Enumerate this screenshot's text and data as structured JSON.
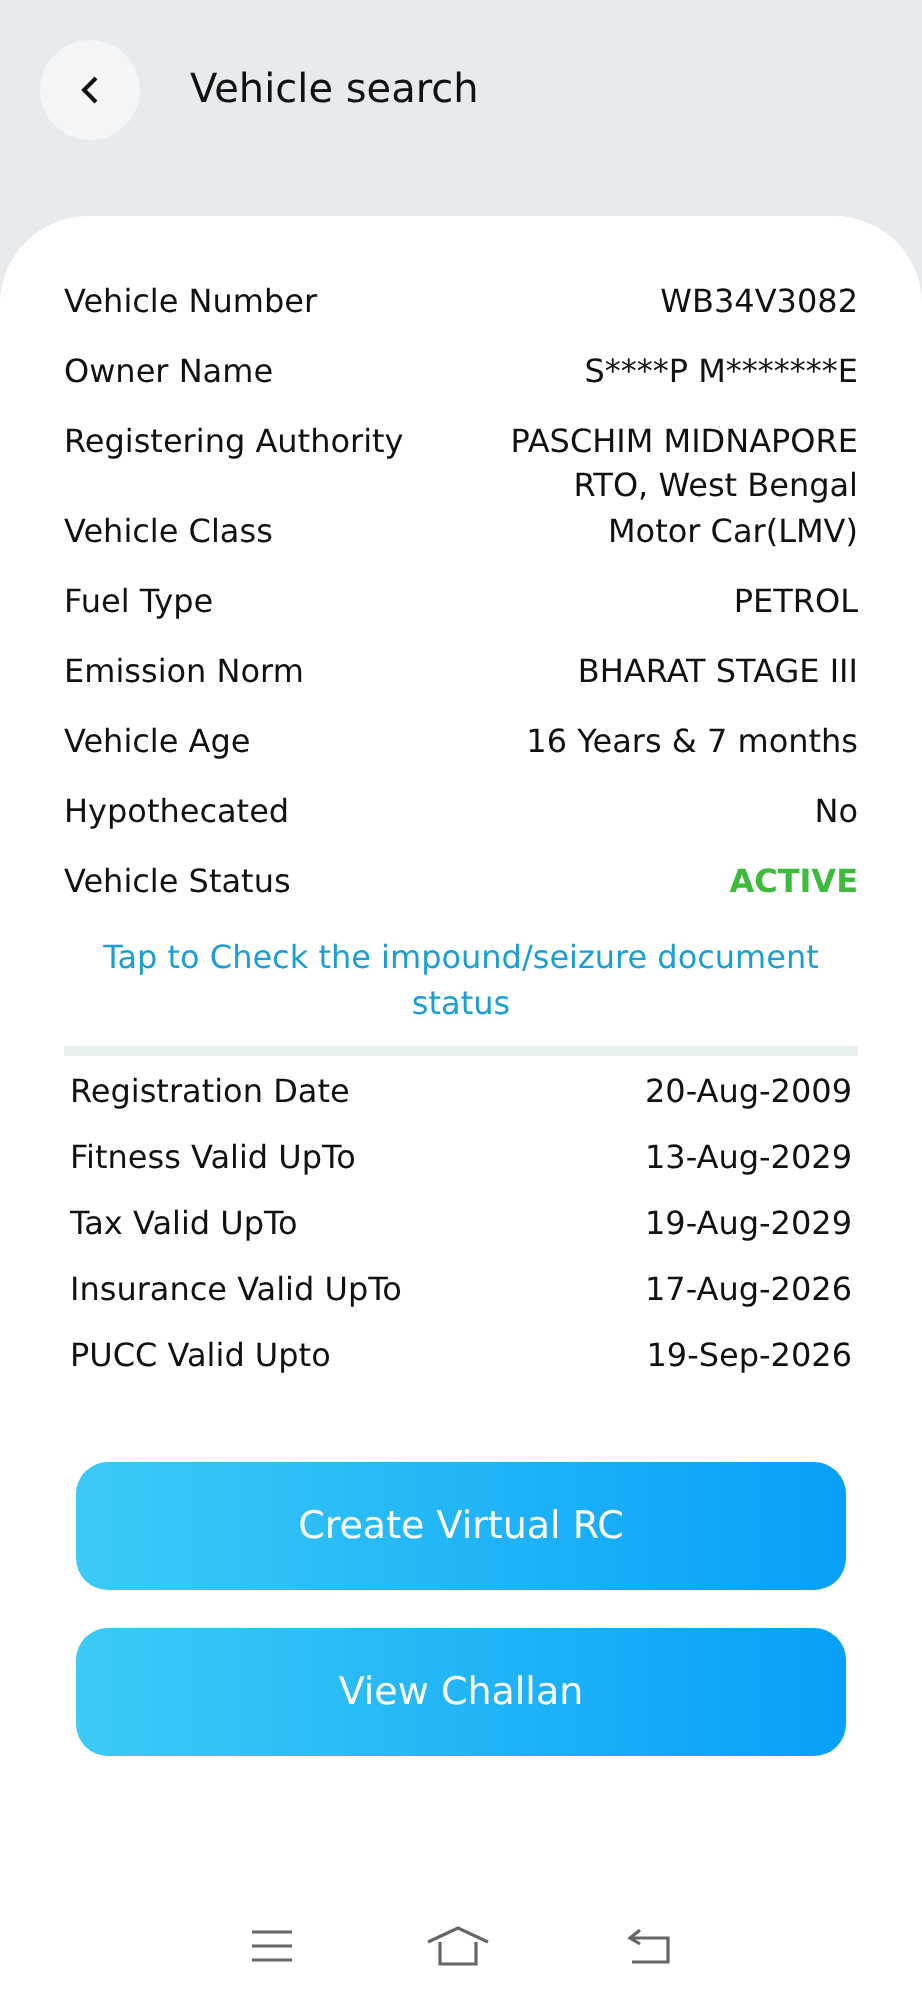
{
  "header": {
    "title": "Vehicle search"
  },
  "details": [
    {
      "label": "Vehicle Number",
      "value": "WB34V3082",
      "kind": "text"
    },
    {
      "label": "Owner Name",
      "value": "S****P M*******E",
      "kind": "text"
    },
    {
      "label": "Registering Authority",
      "value": "PASCHIM MIDNAPORE RTO, West Bengal",
      "kind": "text"
    },
    {
      "label": "Vehicle Class",
      "value": "Motor Car(LMV)",
      "kind": "text"
    },
    {
      "label": "Fuel Type",
      "value": "PETROL",
      "kind": "text"
    },
    {
      "label": "Emission Norm",
      "value": "BHARAT STAGE III",
      "kind": "text"
    },
    {
      "label": "Vehicle Age",
      "value": "16 Years  & 7 months",
      "kind": "text"
    },
    {
      "label": "Hypothecated",
      "value": "No",
      "kind": "text"
    },
    {
      "label": "Vehicle Status",
      "value": "ACTIVE",
      "kind": "status"
    }
  ],
  "impound_link": "Tap to Check the impound/seizure document status",
  "validity": [
    {
      "label": "Registration Date",
      "value": "20-Aug-2009"
    },
    {
      "label": "Fitness Valid UpTo",
      "value": "13-Aug-2029"
    },
    {
      "label": "Tax Valid UpTo",
      "value": "19-Aug-2029"
    },
    {
      "label": "Insurance Valid UpTo",
      "value": "17-Aug-2026"
    },
    {
      "label": "PUCC Valid Upto",
      "value": "19-Sep-2026"
    }
  ],
  "buttons": [
    "Create Virtual RC",
    "View Challan"
  ]
}
